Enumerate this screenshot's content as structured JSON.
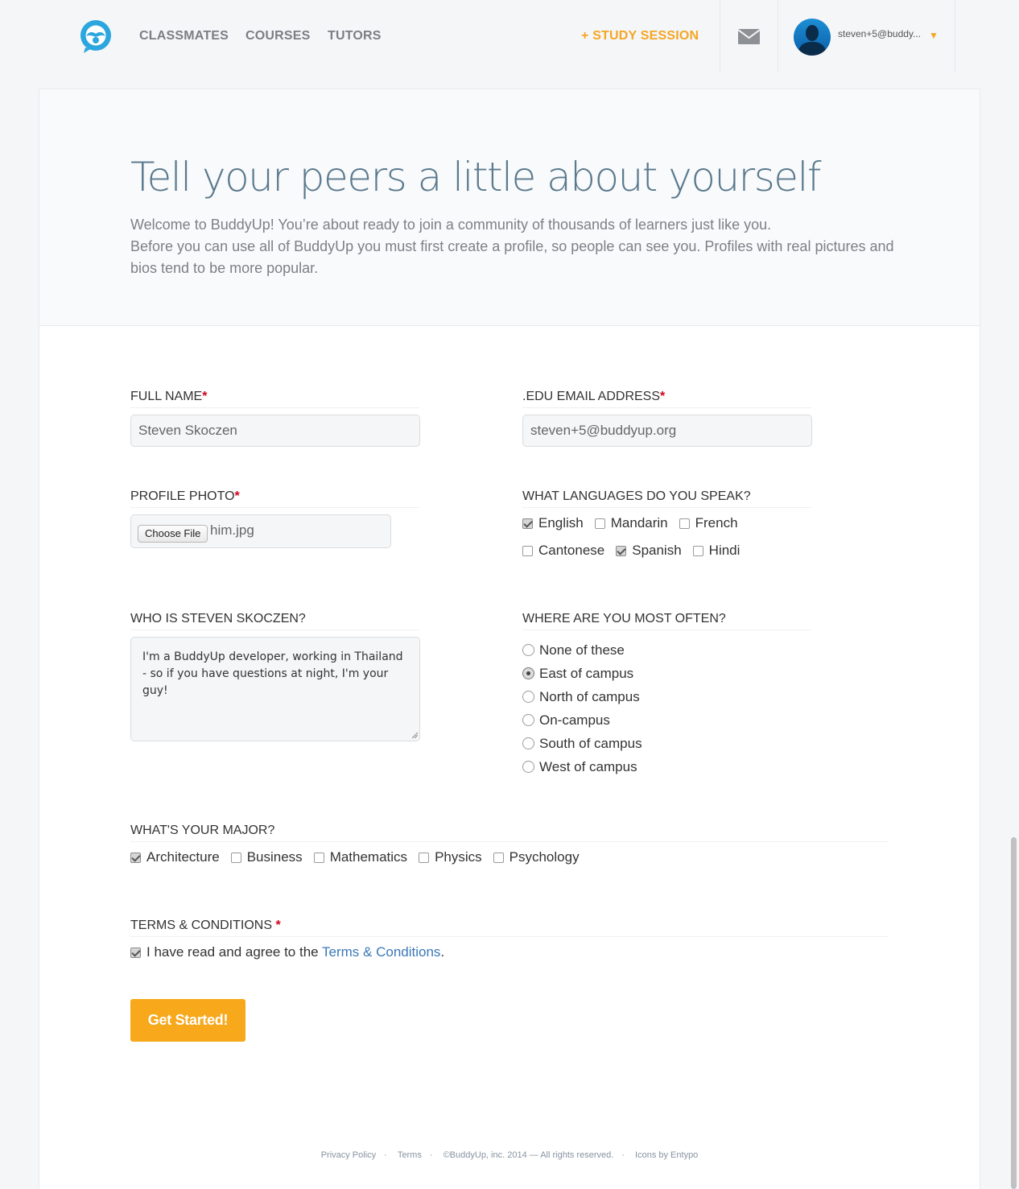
{
  "nav": {
    "links": [
      "CLASSMATES",
      "COURSES",
      "TUTORS"
    ],
    "study_session": "+ STUDY SESSION",
    "user_email": "steven+5@buddy...",
    "caret": "▼"
  },
  "intro": {
    "title": "Tell your peers a little about yourself",
    "line1": "Welcome to BuddyUp! You’re about ready to join a community of thousands of learners just like you.",
    "line2": "Before you can use all of BuddyUp you must first create a profile, so people can see you. Profiles with real pictures and bios tend to be more popular."
  },
  "form": {
    "full_name": {
      "label": "FULL NAME",
      "required": "*",
      "value": "Steven Skoczen"
    },
    "email": {
      "label": ".EDU EMAIL ADDRESS",
      "required": "*",
      "value": "steven+5@buddyup.org"
    },
    "photo": {
      "label": "PROFILE PHOTO",
      "required": "*",
      "button": "Choose File",
      "file_name": "him.jpg"
    },
    "languages": {
      "label": "WHAT LANGUAGES DO YOU SPEAK?",
      "options": [
        {
          "label": "English",
          "checked": true
        },
        {
          "label": "Mandarin",
          "checked": false
        },
        {
          "label": "French",
          "checked": false
        },
        {
          "label": "Cantonese",
          "checked": false
        },
        {
          "label": "Spanish",
          "checked": true
        },
        {
          "label": "Hindi",
          "checked": false
        }
      ]
    },
    "bio": {
      "label": "WHO IS STEVEN SKOCZEN?",
      "value": "I'm a BuddyUp developer, working in Thailand - so if you have questions at night, I'm your guy!"
    },
    "location": {
      "label": "WHERE ARE YOU MOST OFTEN?",
      "options": [
        "None of these",
        "East of campus",
        "North of campus",
        "On-campus",
        "South of campus",
        "West of campus"
      ],
      "selected": "East of campus"
    },
    "major": {
      "label": "WHAT'S YOUR MAJOR?",
      "options": [
        {
          "label": "Architecture",
          "checked": true
        },
        {
          "label": "Business",
          "checked": false
        },
        {
          "label": "Mathematics",
          "checked": false
        },
        {
          "label": "Physics",
          "checked": false
        },
        {
          "label": "Psychology",
          "checked": false
        }
      ]
    },
    "terms": {
      "label": "TERMS & CONDITIONS",
      "required": "*",
      "agree_prefix": "I have read and agree to the ",
      "link": "Terms & Conditions",
      "agree_suffix": ".",
      "checked": true
    },
    "submit": "Get Started!"
  },
  "footer": {
    "privacy": "Privacy Policy",
    "terms": "Terms",
    "copyright": "©BuddyUp, inc. 2014 — All rights reserved.",
    "icons": "Icons by Entypo"
  },
  "colors": {
    "accent": "#f7a81b",
    "logo": "#2ba6de",
    "link": "#3b78b8",
    "title": "#5b7a8e"
  }
}
